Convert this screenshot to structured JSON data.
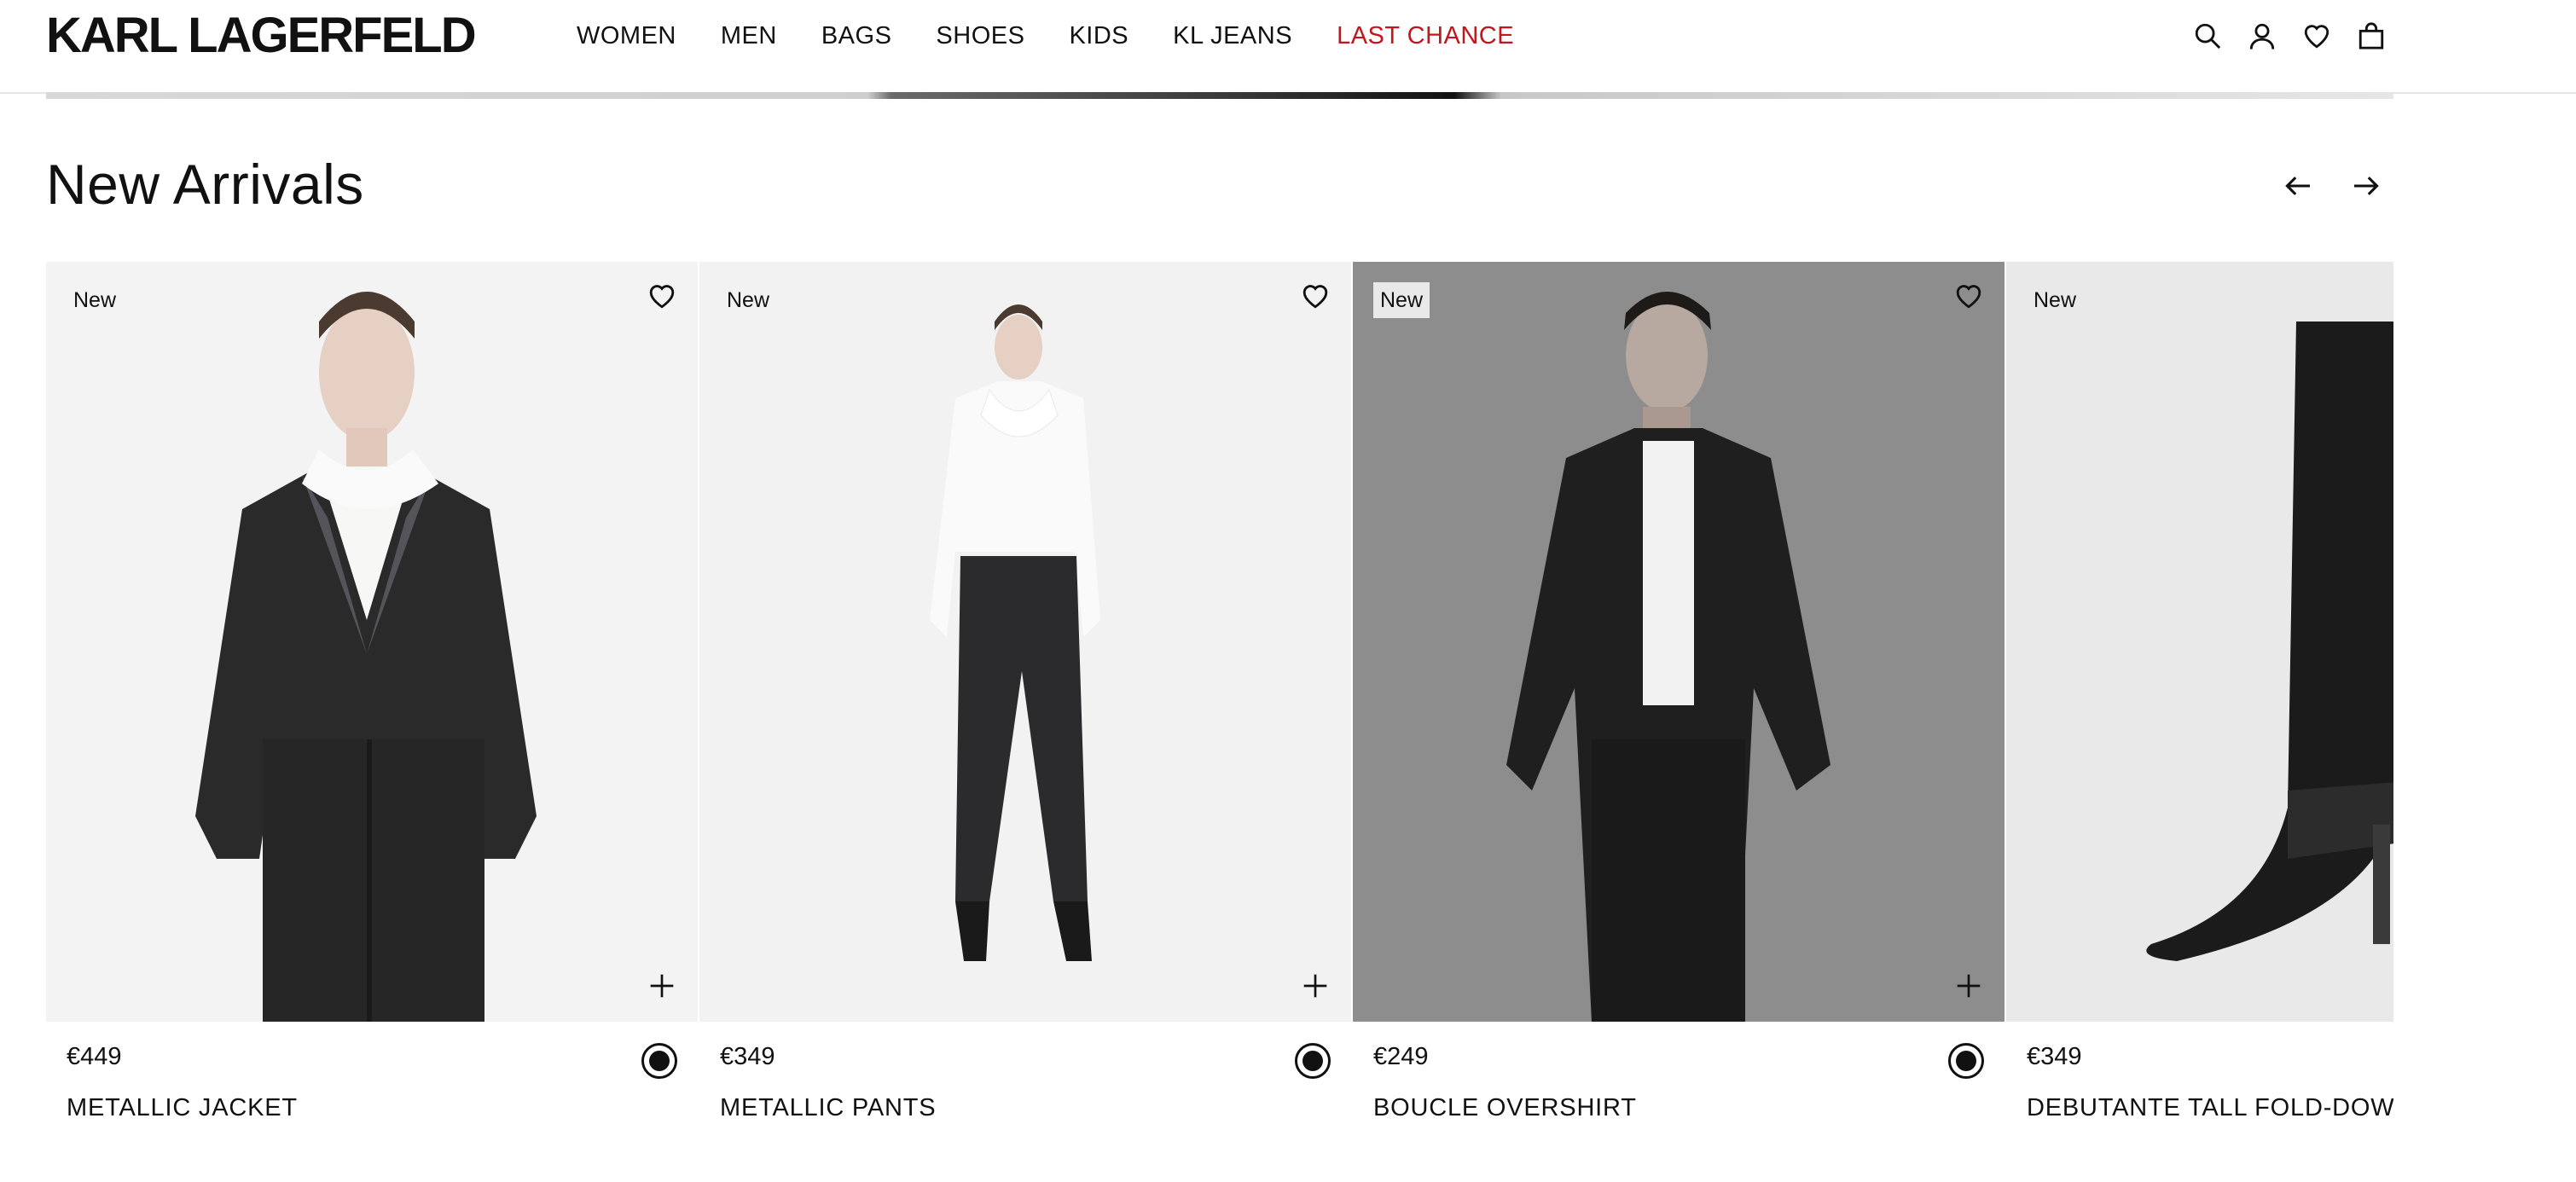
{
  "header": {
    "logo": "KARL LAGERFELD",
    "nav": [
      {
        "label": "WOMEN"
      },
      {
        "label": "MEN"
      },
      {
        "label": "BAGS"
      },
      {
        "label": "SHOES"
      },
      {
        "label": "KIDS"
      },
      {
        "label": "KL JEANS"
      },
      {
        "label": "LAST CHANCE"
      }
    ],
    "icons": [
      "search-icon",
      "account-icon",
      "wishlist-icon",
      "bag-icon"
    ]
  },
  "section": {
    "title": "New Arrivals"
  },
  "colors": {
    "text": "#111111",
    "sale": "#c0161c",
    "divider": "#e5e5e5"
  },
  "products": [
    {
      "badge": "New",
      "price": "€449",
      "name": "METALLIC JACKET"
    },
    {
      "badge": "New",
      "price": "€349",
      "name": "METALLIC PANTS"
    },
    {
      "badge": "New",
      "price": "€249",
      "name": "BOUCLE OVERSHIRT"
    },
    {
      "badge": "New",
      "price": "€349",
      "name": "DEBUTANTE TALL FOLD-DOW"
    }
  ]
}
